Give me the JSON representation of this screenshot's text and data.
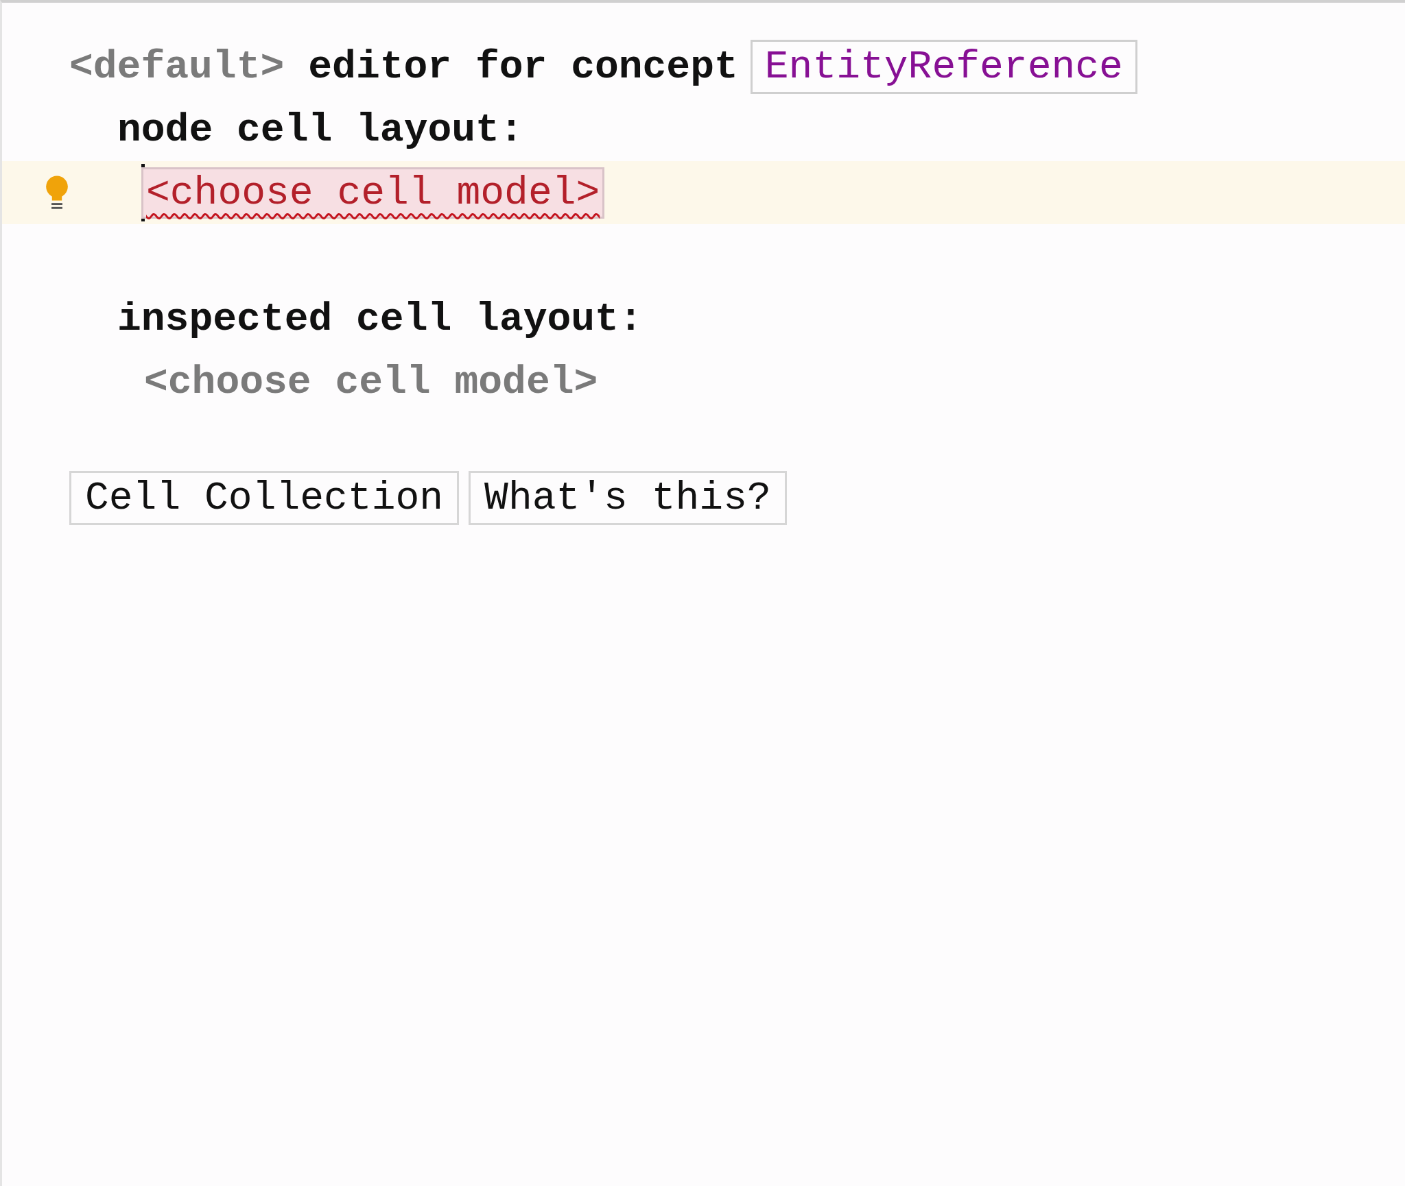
{
  "header": {
    "keyword": "<default>",
    "text": "editor for concept",
    "concept": "EntityReference"
  },
  "sections": [
    {
      "label": "node cell layout:",
      "placeholder": "<choose cell model>",
      "error": true,
      "focused": true
    },
    {
      "label": "inspected cell layout:",
      "placeholder": "<choose cell model>",
      "error": false,
      "focused": false
    }
  ],
  "buttons": [
    "Cell Collection",
    "What's this?"
  ]
}
